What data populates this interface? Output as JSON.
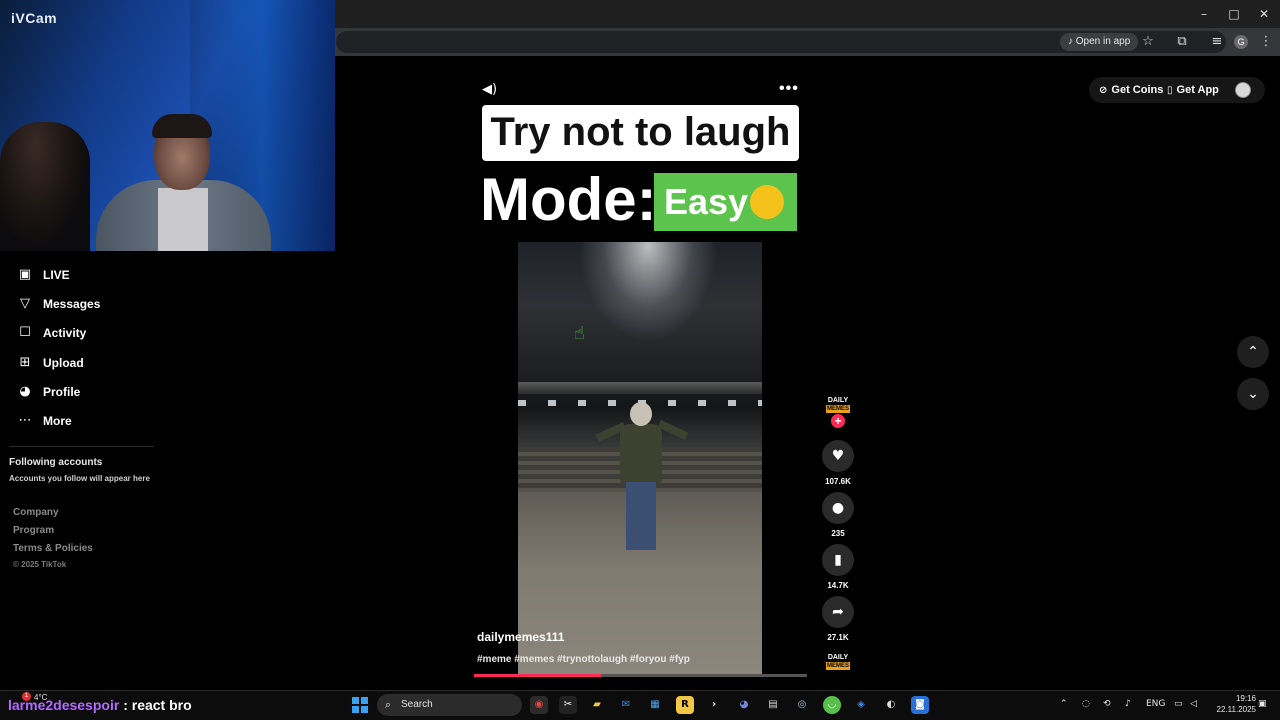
{
  "webcam": {
    "label": "iVCam"
  },
  "browser": {
    "open_in_app": "Open in app",
    "profile_initial": "G",
    "window_controls": {
      "minimize": "–",
      "maximize": "□",
      "close": "✕"
    }
  },
  "nav": {
    "items": [
      {
        "label": "LIVE",
        "icon": "live-icon"
      },
      {
        "label": "Messages",
        "icon": "messages-icon"
      },
      {
        "label": "Activity",
        "icon": "activity-icon"
      },
      {
        "label": "Upload",
        "icon": "upload-icon"
      },
      {
        "label": "Profile",
        "icon": "profile-avatar-icon"
      },
      {
        "label": "More",
        "icon": "more-icon"
      }
    ],
    "following_title": "Following accounts",
    "following_sub": "Accounts you follow will appear here",
    "footer": [
      "Company",
      "Program",
      "Terms & Policies"
    ],
    "copyright": "© 2025 TikTok"
  },
  "top_right": {
    "get_coins": "Get Coins",
    "get_app": "Get App"
  },
  "video": {
    "caption_line1": "Try not to laugh",
    "caption_mode": "Mode:",
    "caption_easy": "Easy",
    "author": "dailymemes111",
    "hashtags": "#meme #memes #trynottolaugh #foryou #fyp",
    "progress_fraction": 0.38
  },
  "creator_badge": {
    "top": "DAILY",
    "bottom": "MEMES"
  },
  "actions": {
    "likes": "107.6K",
    "comments": "235",
    "saves": "14.7K",
    "shares": "27.1K"
  },
  "chat": {
    "user": "larme2desespoir",
    "message": ": react bro"
  },
  "weather": {
    "temp": "4°C"
  },
  "taskbar": {
    "search": "Search",
    "lang": "ENG",
    "time": "19:16",
    "date": "22.11.2025"
  },
  "colors": {
    "accent": "#fe2c55",
    "easy_green": "#5cc44c",
    "chat_user": "#b36bff"
  }
}
